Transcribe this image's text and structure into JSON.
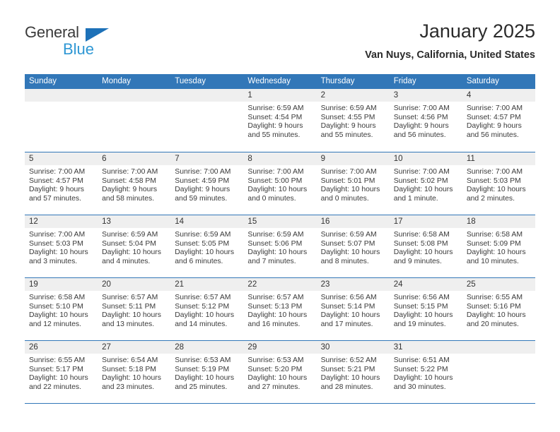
{
  "brand": {
    "name_part1": "General",
    "name_part2": "Blue",
    "triangle_color": "#1d71b8",
    "part2_color": "#2e97d4"
  },
  "header": {
    "title": "January 2025",
    "subtitle": "Van Nuys, California, United States"
  },
  "theme": {
    "header_blue": "#3277b8",
    "day_band_gray": "#efefef",
    "text": "#333333"
  },
  "weekdays": [
    "Sunday",
    "Monday",
    "Tuesday",
    "Wednesday",
    "Thursday",
    "Friday",
    "Saturday"
  ],
  "weeks": [
    [
      {
        "empty": true
      },
      {
        "empty": true
      },
      {
        "empty": true
      },
      {
        "day": "1",
        "sunrise": "Sunrise: 6:59 AM",
        "sunset": "Sunset: 4:54 PM",
        "daylight": "Daylight: 9 hours and 55 minutes."
      },
      {
        "day": "2",
        "sunrise": "Sunrise: 6:59 AM",
        "sunset": "Sunset: 4:55 PM",
        "daylight": "Daylight: 9 hours and 55 minutes."
      },
      {
        "day": "3",
        "sunrise": "Sunrise: 7:00 AM",
        "sunset": "Sunset: 4:56 PM",
        "daylight": "Daylight: 9 hours and 56 minutes."
      },
      {
        "day": "4",
        "sunrise": "Sunrise: 7:00 AM",
        "sunset": "Sunset: 4:57 PM",
        "daylight": "Daylight: 9 hours and 56 minutes."
      }
    ],
    [
      {
        "day": "5",
        "sunrise": "Sunrise: 7:00 AM",
        "sunset": "Sunset: 4:57 PM",
        "daylight": "Daylight: 9 hours and 57 minutes."
      },
      {
        "day": "6",
        "sunrise": "Sunrise: 7:00 AM",
        "sunset": "Sunset: 4:58 PM",
        "daylight": "Daylight: 9 hours and 58 minutes."
      },
      {
        "day": "7",
        "sunrise": "Sunrise: 7:00 AM",
        "sunset": "Sunset: 4:59 PM",
        "daylight": "Daylight: 9 hours and 59 minutes."
      },
      {
        "day": "8",
        "sunrise": "Sunrise: 7:00 AM",
        "sunset": "Sunset: 5:00 PM",
        "daylight": "Daylight: 10 hours and 0 minutes."
      },
      {
        "day": "9",
        "sunrise": "Sunrise: 7:00 AM",
        "sunset": "Sunset: 5:01 PM",
        "daylight": "Daylight: 10 hours and 0 minutes."
      },
      {
        "day": "10",
        "sunrise": "Sunrise: 7:00 AM",
        "sunset": "Sunset: 5:02 PM",
        "daylight": "Daylight: 10 hours and 1 minute."
      },
      {
        "day": "11",
        "sunrise": "Sunrise: 7:00 AM",
        "sunset": "Sunset: 5:03 PM",
        "daylight": "Daylight: 10 hours and 2 minutes."
      }
    ],
    [
      {
        "day": "12",
        "sunrise": "Sunrise: 7:00 AM",
        "sunset": "Sunset: 5:03 PM",
        "daylight": "Daylight: 10 hours and 3 minutes."
      },
      {
        "day": "13",
        "sunrise": "Sunrise: 6:59 AM",
        "sunset": "Sunset: 5:04 PM",
        "daylight": "Daylight: 10 hours and 4 minutes."
      },
      {
        "day": "14",
        "sunrise": "Sunrise: 6:59 AM",
        "sunset": "Sunset: 5:05 PM",
        "daylight": "Daylight: 10 hours and 6 minutes."
      },
      {
        "day": "15",
        "sunrise": "Sunrise: 6:59 AM",
        "sunset": "Sunset: 5:06 PM",
        "daylight": "Daylight: 10 hours and 7 minutes."
      },
      {
        "day": "16",
        "sunrise": "Sunrise: 6:59 AM",
        "sunset": "Sunset: 5:07 PM",
        "daylight": "Daylight: 10 hours and 8 minutes."
      },
      {
        "day": "17",
        "sunrise": "Sunrise: 6:58 AM",
        "sunset": "Sunset: 5:08 PM",
        "daylight": "Daylight: 10 hours and 9 minutes."
      },
      {
        "day": "18",
        "sunrise": "Sunrise: 6:58 AM",
        "sunset": "Sunset: 5:09 PM",
        "daylight": "Daylight: 10 hours and 10 minutes."
      }
    ],
    [
      {
        "day": "19",
        "sunrise": "Sunrise: 6:58 AM",
        "sunset": "Sunset: 5:10 PM",
        "daylight": "Daylight: 10 hours and 12 minutes."
      },
      {
        "day": "20",
        "sunrise": "Sunrise: 6:57 AM",
        "sunset": "Sunset: 5:11 PM",
        "daylight": "Daylight: 10 hours and 13 minutes."
      },
      {
        "day": "21",
        "sunrise": "Sunrise: 6:57 AM",
        "sunset": "Sunset: 5:12 PM",
        "daylight": "Daylight: 10 hours and 14 minutes."
      },
      {
        "day": "22",
        "sunrise": "Sunrise: 6:57 AM",
        "sunset": "Sunset: 5:13 PM",
        "daylight": "Daylight: 10 hours and 16 minutes."
      },
      {
        "day": "23",
        "sunrise": "Sunrise: 6:56 AM",
        "sunset": "Sunset: 5:14 PM",
        "daylight": "Daylight: 10 hours and 17 minutes."
      },
      {
        "day": "24",
        "sunrise": "Sunrise: 6:56 AM",
        "sunset": "Sunset: 5:15 PM",
        "daylight": "Daylight: 10 hours and 19 minutes."
      },
      {
        "day": "25",
        "sunrise": "Sunrise: 6:55 AM",
        "sunset": "Sunset: 5:16 PM",
        "daylight": "Daylight: 10 hours and 20 minutes."
      }
    ],
    [
      {
        "day": "26",
        "sunrise": "Sunrise: 6:55 AM",
        "sunset": "Sunset: 5:17 PM",
        "daylight": "Daylight: 10 hours and 22 minutes."
      },
      {
        "day": "27",
        "sunrise": "Sunrise: 6:54 AM",
        "sunset": "Sunset: 5:18 PM",
        "daylight": "Daylight: 10 hours and 23 minutes."
      },
      {
        "day": "28",
        "sunrise": "Sunrise: 6:53 AM",
        "sunset": "Sunset: 5:19 PM",
        "daylight": "Daylight: 10 hours and 25 minutes."
      },
      {
        "day": "29",
        "sunrise": "Sunrise: 6:53 AM",
        "sunset": "Sunset: 5:20 PM",
        "daylight": "Daylight: 10 hours and 27 minutes."
      },
      {
        "day": "30",
        "sunrise": "Sunrise: 6:52 AM",
        "sunset": "Sunset: 5:21 PM",
        "daylight": "Daylight: 10 hours and 28 minutes."
      },
      {
        "day": "31",
        "sunrise": "Sunrise: 6:51 AM",
        "sunset": "Sunset: 5:22 PM",
        "daylight": "Daylight: 10 hours and 30 minutes."
      },
      {
        "empty": true
      }
    ]
  ]
}
